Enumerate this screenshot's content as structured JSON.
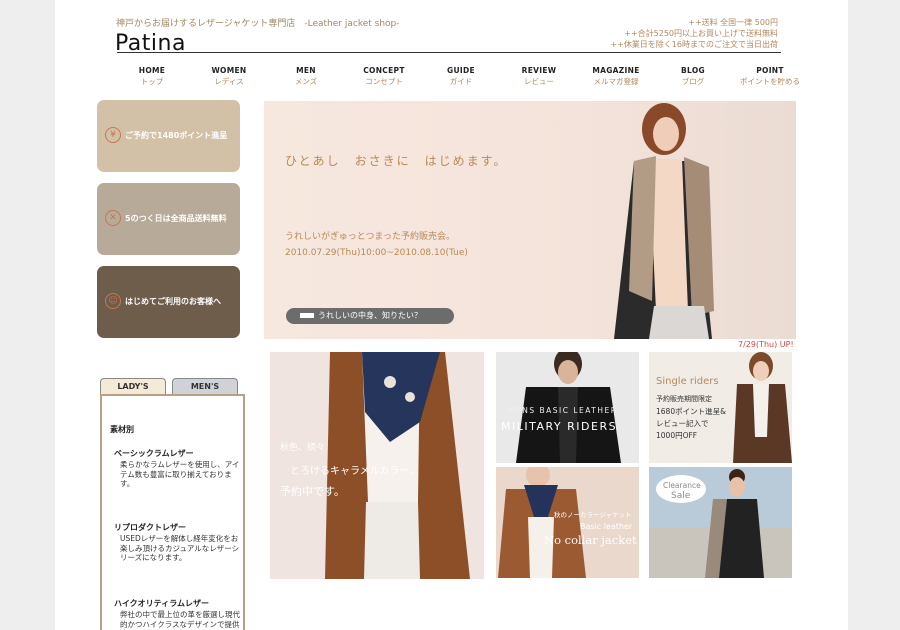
{
  "header": {
    "tagline": "神戸からお届けするレザージャケット専門店　-Leather jacket shop-",
    "logo": "Patina",
    "notices": [
      "++送料 全国一律 500円",
      "++合計5250円以上お買い上げで送料無料",
      "++休業日を除く16時までのご注文で当日出荷"
    ]
  },
  "nav": [
    {
      "en": "HOME",
      "ja": "トップ"
    },
    {
      "en": "WOMEN",
      "ja": "レディス"
    },
    {
      "en": "MEN",
      "ja": "メンズ"
    },
    {
      "en": "CONCEPT",
      "ja": "コンセプト"
    },
    {
      "en": "GUIDE",
      "ja": "ガイド"
    },
    {
      "en": "REVIEW",
      "ja": "レビュー"
    },
    {
      "en": "MAGAZINE",
      "ja": "メルマガ登録"
    },
    {
      "en": "BLOG",
      "ja": "ブログ"
    },
    {
      "en": "POINT",
      "ja": "ポイントを貯める"
    }
  ],
  "banners": [
    {
      "text": "ご予約で1480ポイント進呈"
    },
    {
      "text": "5のつく日は全商品送料無料"
    },
    {
      "text": "はじめてご利用のお客様へ"
    }
  ],
  "hero": {
    "headline": "ひとあし　おさきに　はじめます。",
    "subline": "うれしいがぎゅっとつまった予約販売会。",
    "dates": "2010.07.29(Thu)10:00~2010.08.10(Tue)",
    "button": "うれしいの中身、知りたい？",
    "update": "7/29(Thu) UP!"
  },
  "tiles": {
    "caramel": {
      "line1": "秋色、続々",
      "line2": "とろけるキャラメルカラー、",
      "line3": "予約中です。"
    },
    "military": {
      "line1": "MENS BASIC LEATHER",
      "line2": "MILITARY RIDERS"
    },
    "single": {
      "title": "Single riders",
      "l1": "予約販売期間限定",
      "l2": "1680ポイント進呈&",
      "l3": "レビュー記入で",
      "l4": "1000円OFF"
    },
    "nocollar": {
      "l1": "秋のノーカラージャケット",
      "l2": "Basic leather",
      "l3": "No collar jacket"
    },
    "clearance": {
      "l1": "Clearance",
      "l2": "Sale"
    }
  },
  "sidebar": {
    "tabs": [
      "LADY'S",
      "MEN'S"
    ],
    "section_title": "素材別",
    "categories": [
      {
        "name": "ベーシックラムレザー",
        "desc": "柔らかなラムレザーを使用し、アイテム数も豊富に取り揃えております。"
      },
      {
        "name": "リプロダクトレザー",
        "desc": "USEDレザーを解体し経年変化をお楽しみ頂けるカジュアルなレザーシリーズになります。"
      },
      {
        "name": "ハイクオリティラムレザー",
        "desc": "弊社の中で最上位の革を厳選し現代的かつハイクラスなデザインで提供致しております。"
      }
    ]
  }
}
